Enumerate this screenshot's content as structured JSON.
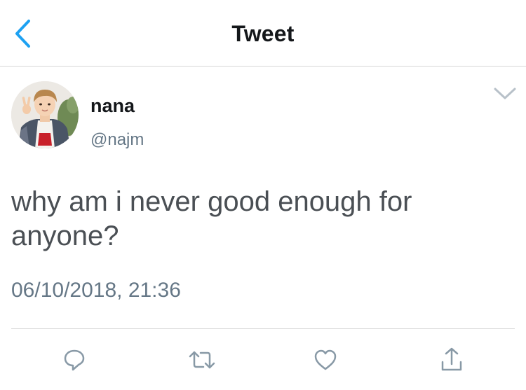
{
  "header": {
    "title": "Tweet",
    "back_icon": "chevron-left-icon",
    "accent_color": "#1da1f2"
  },
  "tweet": {
    "author": {
      "display_name": "nana",
      "handle": "@najm"
    },
    "text": "why am i never good enough for anyone?",
    "timestamp": "06/10/2018, 21:36",
    "menu_icon": "chevron-down-icon"
  },
  "actions": [
    {
      "icon": "reply-icon"
    },
    {
      "icon": "retweet-icon"
    },
    {
      "icon": "like-icon"
    },
    {
      "icon": "share-icon"
    }
  ],
  "colors": {
    "text_primary": "#14171a",
    "text_secondary": "#657786",
    "icon_gray": "#8899a6",
    "divider": "#d6d6d6"
  }
}
